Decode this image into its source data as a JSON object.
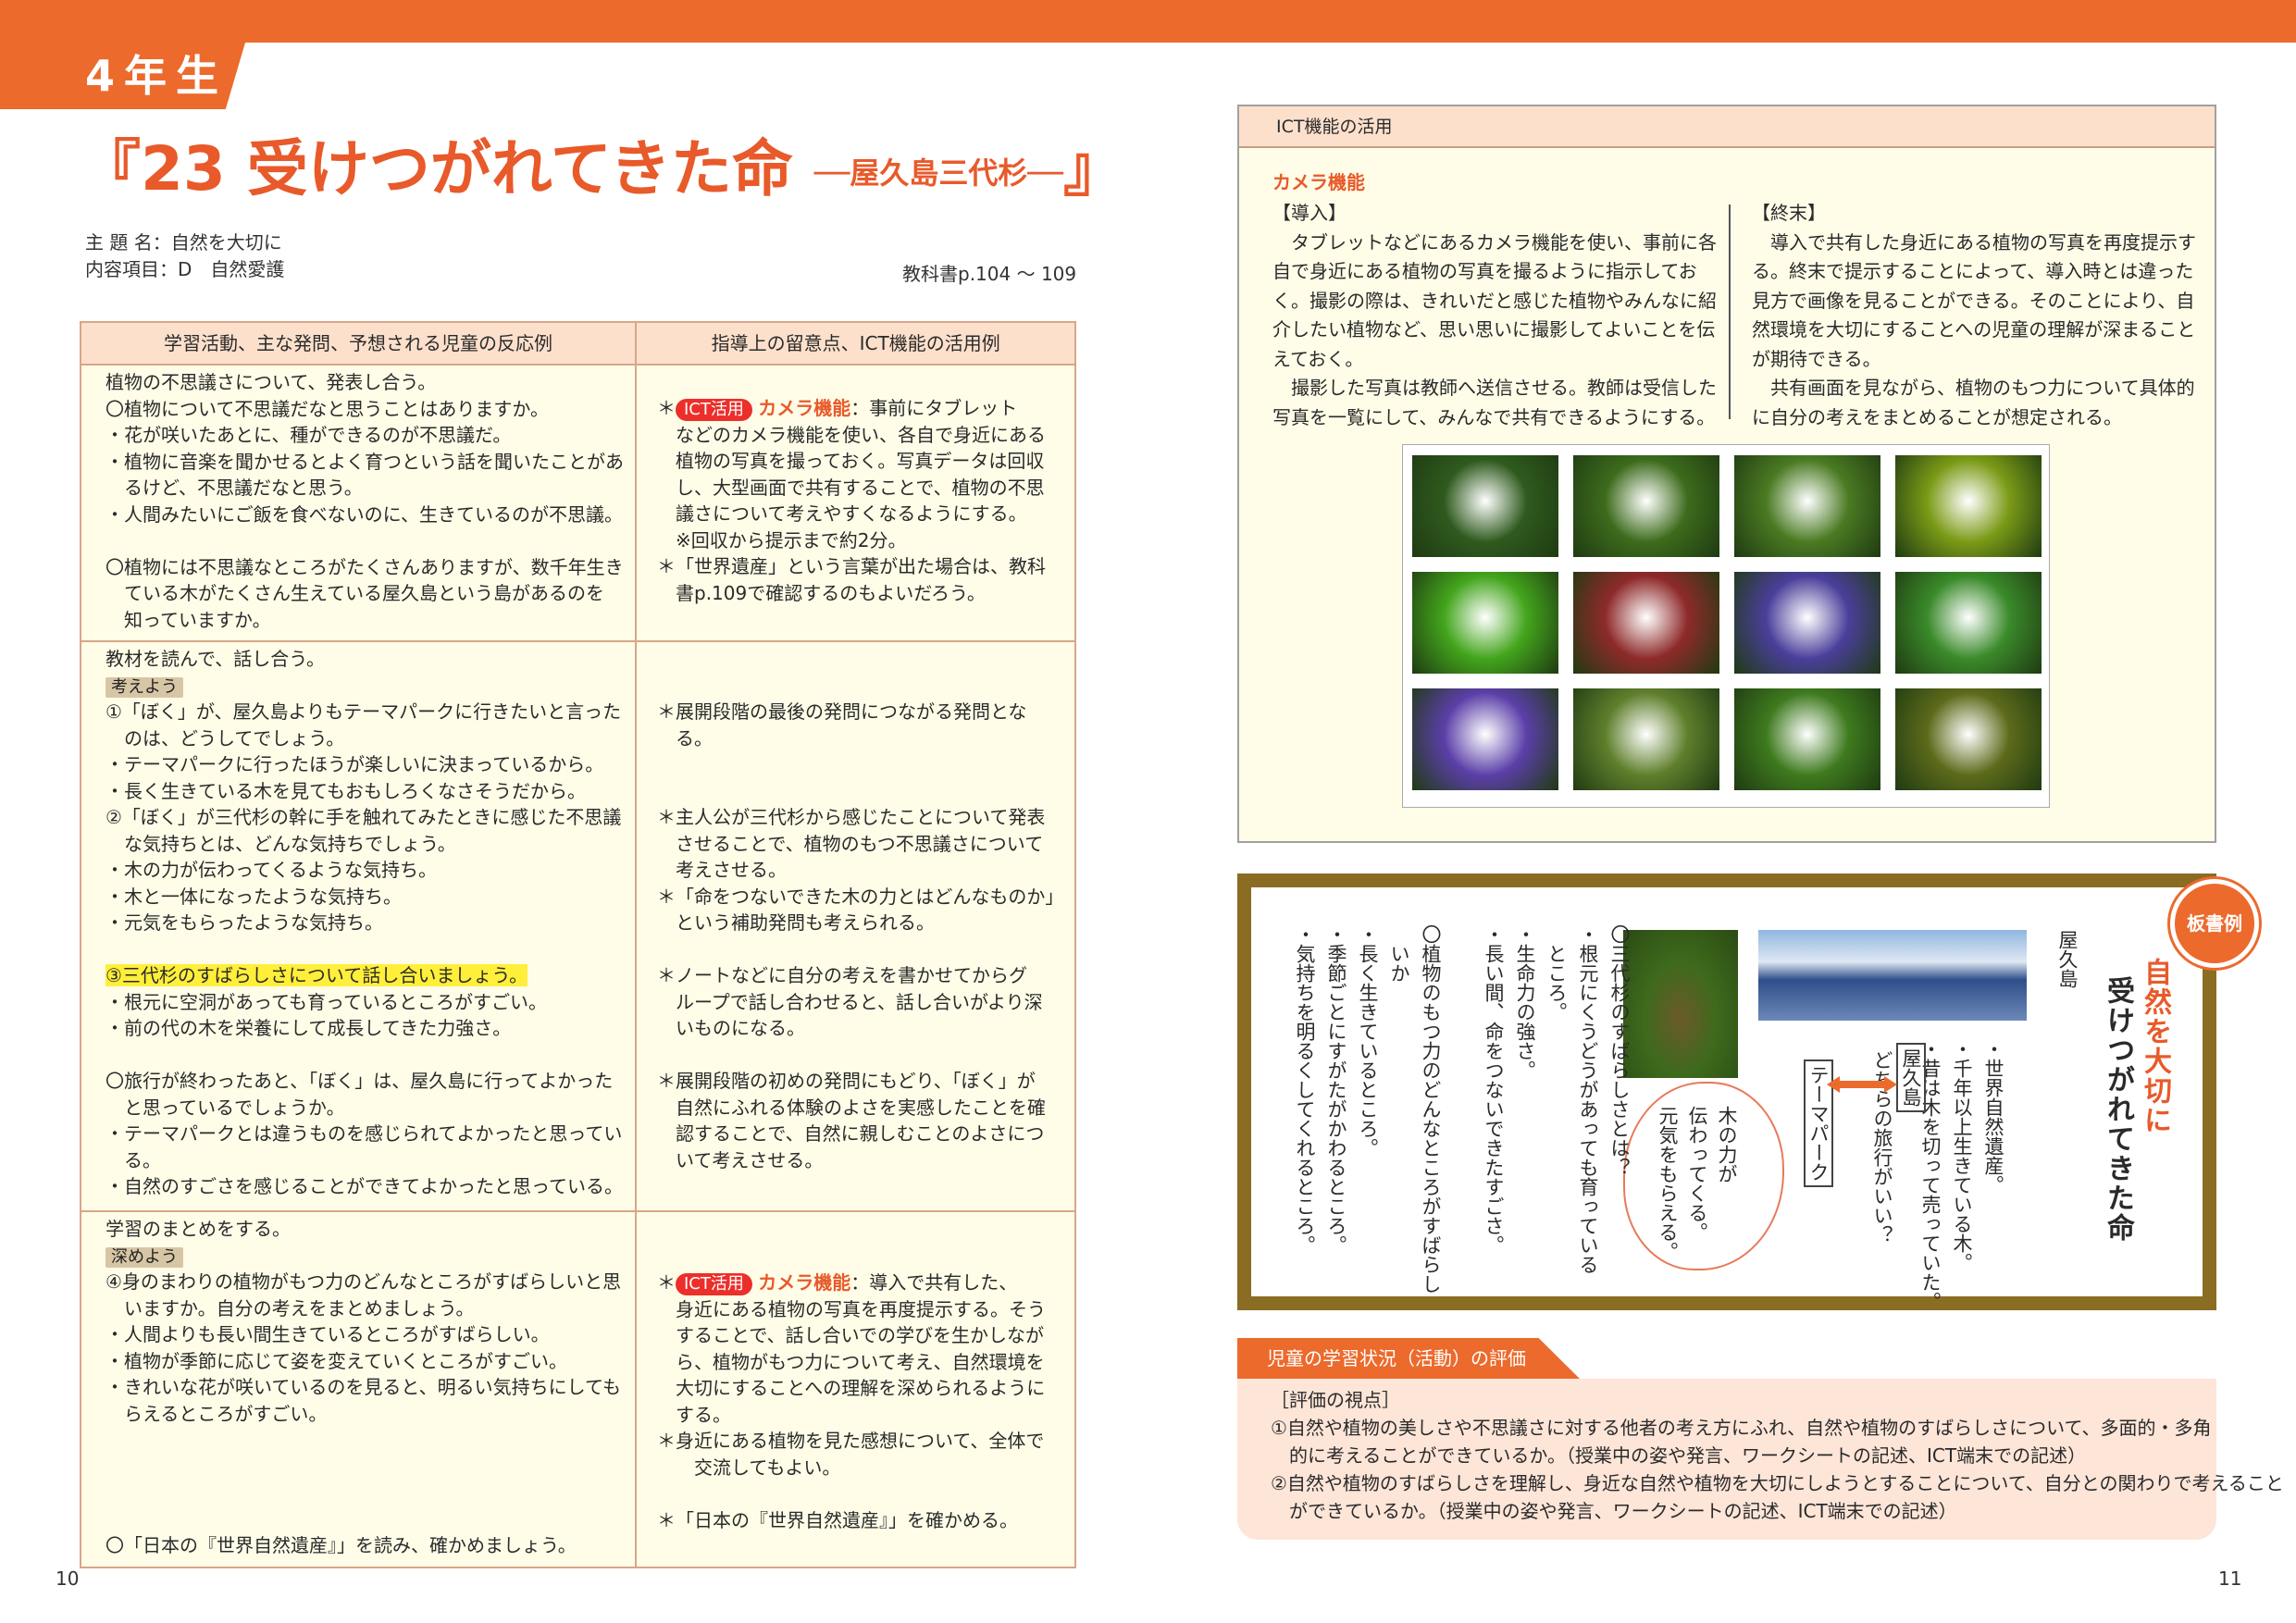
{
  "header": {
    "grade": "4年生"
  },
  "lesson": {
    "title_main": "『23 受けつがれてきた命",
    "title_sub": "──屋久島三代杉──",
    "title_close": "』",
    "theme_label": "主 題 名：",
    "theme": "自然を大切に",
    "content_label": "内容項目：",
    "content": "D　自然愛護",
    "textbook_page": "教科書p.104 ～ 109"
  },
  "table": {
    "headers": [
      "学習活動、主な発問、予想される児童の反応例",
      "指導上の留意点、ICT機能の活用例"
    ],
    "r1": {
      "left": [
        "植物の不思議さについて、発表し合う。",
        "〇植物について不思議だなと思うことはありますか。",
        "・花が咲いたあとに、種ができるのが不思議だ。",
        "・植物に音楽を聞かせるとよく育つという話を聞いたことがあ",
        "　るけど、不思議だなと思う。",
        "・人間みたいにご飯を食べないのに、生きているのが不思議。",
        "",
        "〇植物には不思議なところがたくさんありますが、数千年生き",
        "　ている木がたくさん生えている屋久島という島があるのを",
        "　知っていますか。"
      ],
      "ict_tag": "ICT活用",
      "camera": "カメラ機能",
      "right": [
        "：事前にタブレット",
        "などのカメラ機能を使い、各自で身近にある",
        "植物の写真を撮っておく。写真データは回収",
        "し、大型画面で共有することで、植物の不思",
        "議さについて考えやすくなるようにする。",
        "※回収から提示まで約2分。",
        "＊「世界遺産」という言葉が出た場合は、教科",
        "書p.109で確認するのもよいだろう。"
      ]
    },
    "r2": {
      "intro": "教材を読んで、話し合う。",
      "tag": "考えよう",
      "left": [
        "①「ぼく」が、屋久島よりもテーマパークに行きたいと言った",
        "　のは、どうしてでしょう。",
        "・テーマパークに行ったほうが楽しいに決まっているから。",
        "・長く生きている木を見てもおもしろくなさそうだから。",
        "②「ぼく」が三代杉の幹に手を触れてみたときに感じた不思議",
        "　な気持ちとは、どんな気持ちでしょう。",
        "・木の力が伝わってくるような気持ち。",
        "・木と一体になったような気持ち。",
        "・元気をもらったような気持ち。",
        ""
      ],
      "hl": "③三代杉のすばらしさについて話し合いましょう。",
      "left2": [
        "・根元に空洞があっても育っているところがすごい。",
        "・前の代の木を栄養にして成長してきた力強さ。",
        "",
        "〇旅行が終わったあと、「ぼく」は、屋久島に行ってよかった",
        "　と思っているでしょうか。",
        "・テーマパークとは違うものを感じられてよかったと思ってい",
        "　る。",
        "・自然のすごさを感じることができてよかったと思っている。"
      ],
      "right": [
        "",
        "",
        "＊展開段階の最後の発問につながる発問とな",
        "　る。",
        "",
        "",
        "＊主人公が三代杉から感じたことについて発表",
        "　させることで、植物のもつ不思議さについて",
        "　考えさせる。",
        "＊「命をつないできた木の力とはどんなものか」",
        "　という補助発問も考えられる。",
        "",
        "＊ノートなどに自分の考えを書かせてからグ",
        "　ループで話し合わせると、話し合いがより深",
        "　いものになる。",
        "",
        "＊展開段階の初めの発問にもどり、「ぼく」が",
        "　自然にふれる体験のよさを実感したことを確",
        "　認することで、自然に親しむことのよさにつ",
        "　いて考えさせる。"
      ]
    },
    "r3": {
      "intro": "学習のまとめをする。",
      "tag": "深めよう",
      "left": [
        "④身のまわりの植物がもつ力のどんなところがすばらしいと思",
        "　いますか。自分の考えをまとめましょう。",
        "・人間よりも長い間生きているところがすばらしい。",
        "・植物が季節に応じて姿を変えていくところがすごい。",
        "・きれいな花が咲いているのを見ると、明るい気持ちにしても",
        "　らえるところがすごい。",
        "",
        "",
        "",
        ""
      ],
      "last": "〇「日本の『世界自然遺産』」を読み、確かめましょう。",
      "ict_tag": "ICT活用",
      "camera": "カメラ機能",
      "right": [
        "：導入で共有した、",
        "身近にある植物の写真を再度提示する。そう",
        "することで、話し合いでの学びを生かしなが",
        "ら、植物がもつ力について考え、自然環境を",
        "大切にすることへの理解を深められるように",
        "する。",
        "＊身近にある植物を見た感想について、全体で",
        "　交流してもよい。",
        "",
        "＊「日本の『世界自然遺産』」を確かめる。"
      ]
    }
  },
  "ict_panel": {
    "heading": "ICT機能の活用",
    "camera": "カメラ機能",
    "col1": [
      "【導入】",
      "　タブレットなどにあるカメラ機能を使い、事前に各",
      "自で身近にある植物の写真を撮るように指示してお",
      "く。撮影の際は、きれいだと感じた植物やみんなに紹",
      "介したい植物など、思い思いに撮影してよいことを伝",
      "えておく。",
      "　撮影した写真は教師へ送信させる。教師は受信した",
      "写真を一覧にして、みんなで共有できるようにする。"
    ],
    "col2": [
      "【終末】",
      "　導入で共有した身近にある植物の写真を再度提示す",
      "る。終末で提示することによって、導入時とは違った",
      "見方で画像を見ることができる。そのことにより、自",
      "然環境を大切にすることへの児童の理解が深まること",
      "が期待できる。",
      "　共有画面を見ながら、植物のもつ力について具体的",
      "に自分の考えをまとめることが想定される。"
    ],
    "photo_colors": [
      "#2f5a1e",
      "#3d6b1c",
      "#4a7a22",
      "#7a9a16",
      "#43a51c",
      "#8e2a2a",
      "#4a3f9a",
      "#3a8a2a",
      "#5b3fa8",
      "#5f7f2c",
      "#3e7a1e",
      "#5c6a1a"
    ]
  },
  "board": {
    "badge": "板書例",
    "title1": "自然を大切に",
    "title2": "受けつがれてきた命",
    "yakushima": "屋久島",
    "facts": [
      "・世界自然遺産。",
      "・千年以上生きている木。",
      "・昔は木を切って売っていた。"
    ],
    "question": "どちらの旅行がいい？",
    "opt1": "屋久島",
    "opt2": "テーマパーク",
    "bubble": [
      "木の力が",
      "伝わってくる。",
      "元気をもらえる。"
    ],
    "q3": [
      "〇三代杉のすばらしさとは？",
      "・根元にくうどうがあっても育っている",
      "　ところ。",
      "・生命力の強さ。",
      "・長い間、命をつないできたすごさ。",
      "",
      "〇植物のもつ力のどんなところがすばらし",
      "　いか",
      "・長く生きているところ。",
      "・季節ごとにすがたがかわるところ。",
      "・気持ちを明るくしてくれるところ。"
    ]
  },
  "evaluation": {
    "heading": "児童の学習状況（活動）の評価",
    "lines": [
      "［評価の視点］",
      "①自然や植物の美しさや不思議さに対する他者の考え方にふれ、自然や植物のすばらしさについて、多面的・多角",
      "　的に考えることができているか。（授業中の姿や発言、ワークシートの記述、ICT端末での記述）",
      "②自然や植物のすばらしさを理解し、身近な自然や植物を大切にしようとすることについて、自分との関わりで考えること",
      "　ができているか。（授業中の姿や発言、ワークシートの記述、ICT端末での記述）"
    ]
  },
  "pages": {
    "left": "10",
    "right": "11"
  }
}
